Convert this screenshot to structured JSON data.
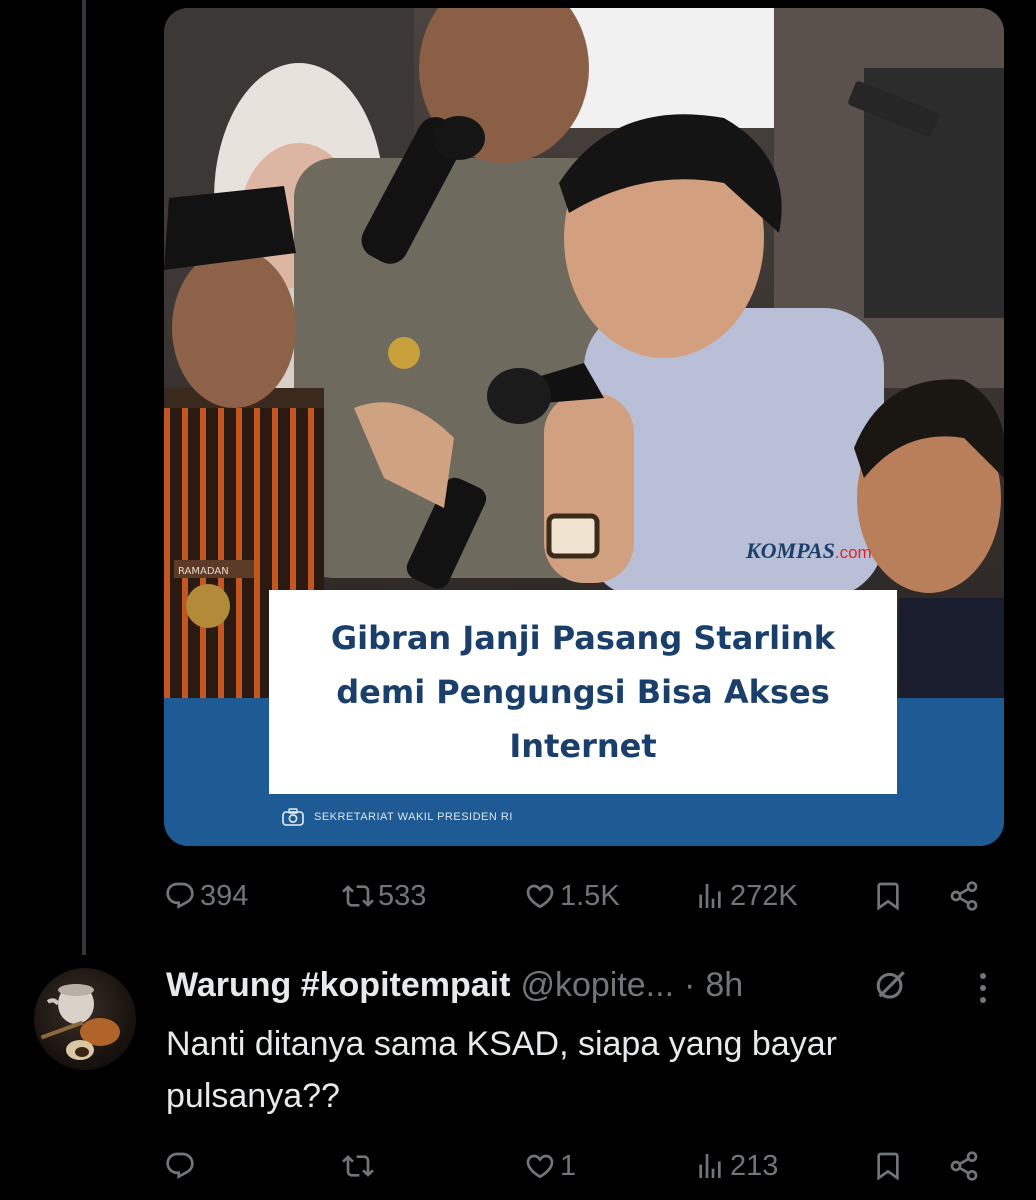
{
  "tweet_media": {
    "headline": "Gibran Janji Pasang Starlink demi Pengungsi Bisa Akses Internet",
    "brand_name": "KOMPAS",
    "brand_suffix": ".com",
    "photo_credit": "SEKRETARIAT WAKIL PRESIDEN RI",
    "name_tag": "RAMADAN"
  },
  "tweet_actions": {
    "replies": "394",
    "reposts": "533",
    "likes": "1.5K",
    "views": "272K"
  },
  "reply": {
    "display_name": "Warung #kopitempait",
    "handle": "@kopite...",
    "separator": "·",
    "time": "8h",
    "text": "Nanti ditanya sama KSAD, siapa yang bayar pulsanya??",
    "actions": {
      "replies": "",
      "reposts": "",
      "likes": "1",
      "views": "213"
    }
  },
  "icons": [
    "reply-icon",
    "repost-icon",
    "like-icon",
    "views-icon",
    "bookmark-icon",
    "share-icon",
    "grok-icon",
    "more-icon",
    "camera-icon"
  ],
  "colors": {
    "background": "#000000",
    "text": "#e7e9ea",
    "muted": "#71767b",
    "band": "#1e5a94",
    "headline": "#1b3f6b"
  }
}
